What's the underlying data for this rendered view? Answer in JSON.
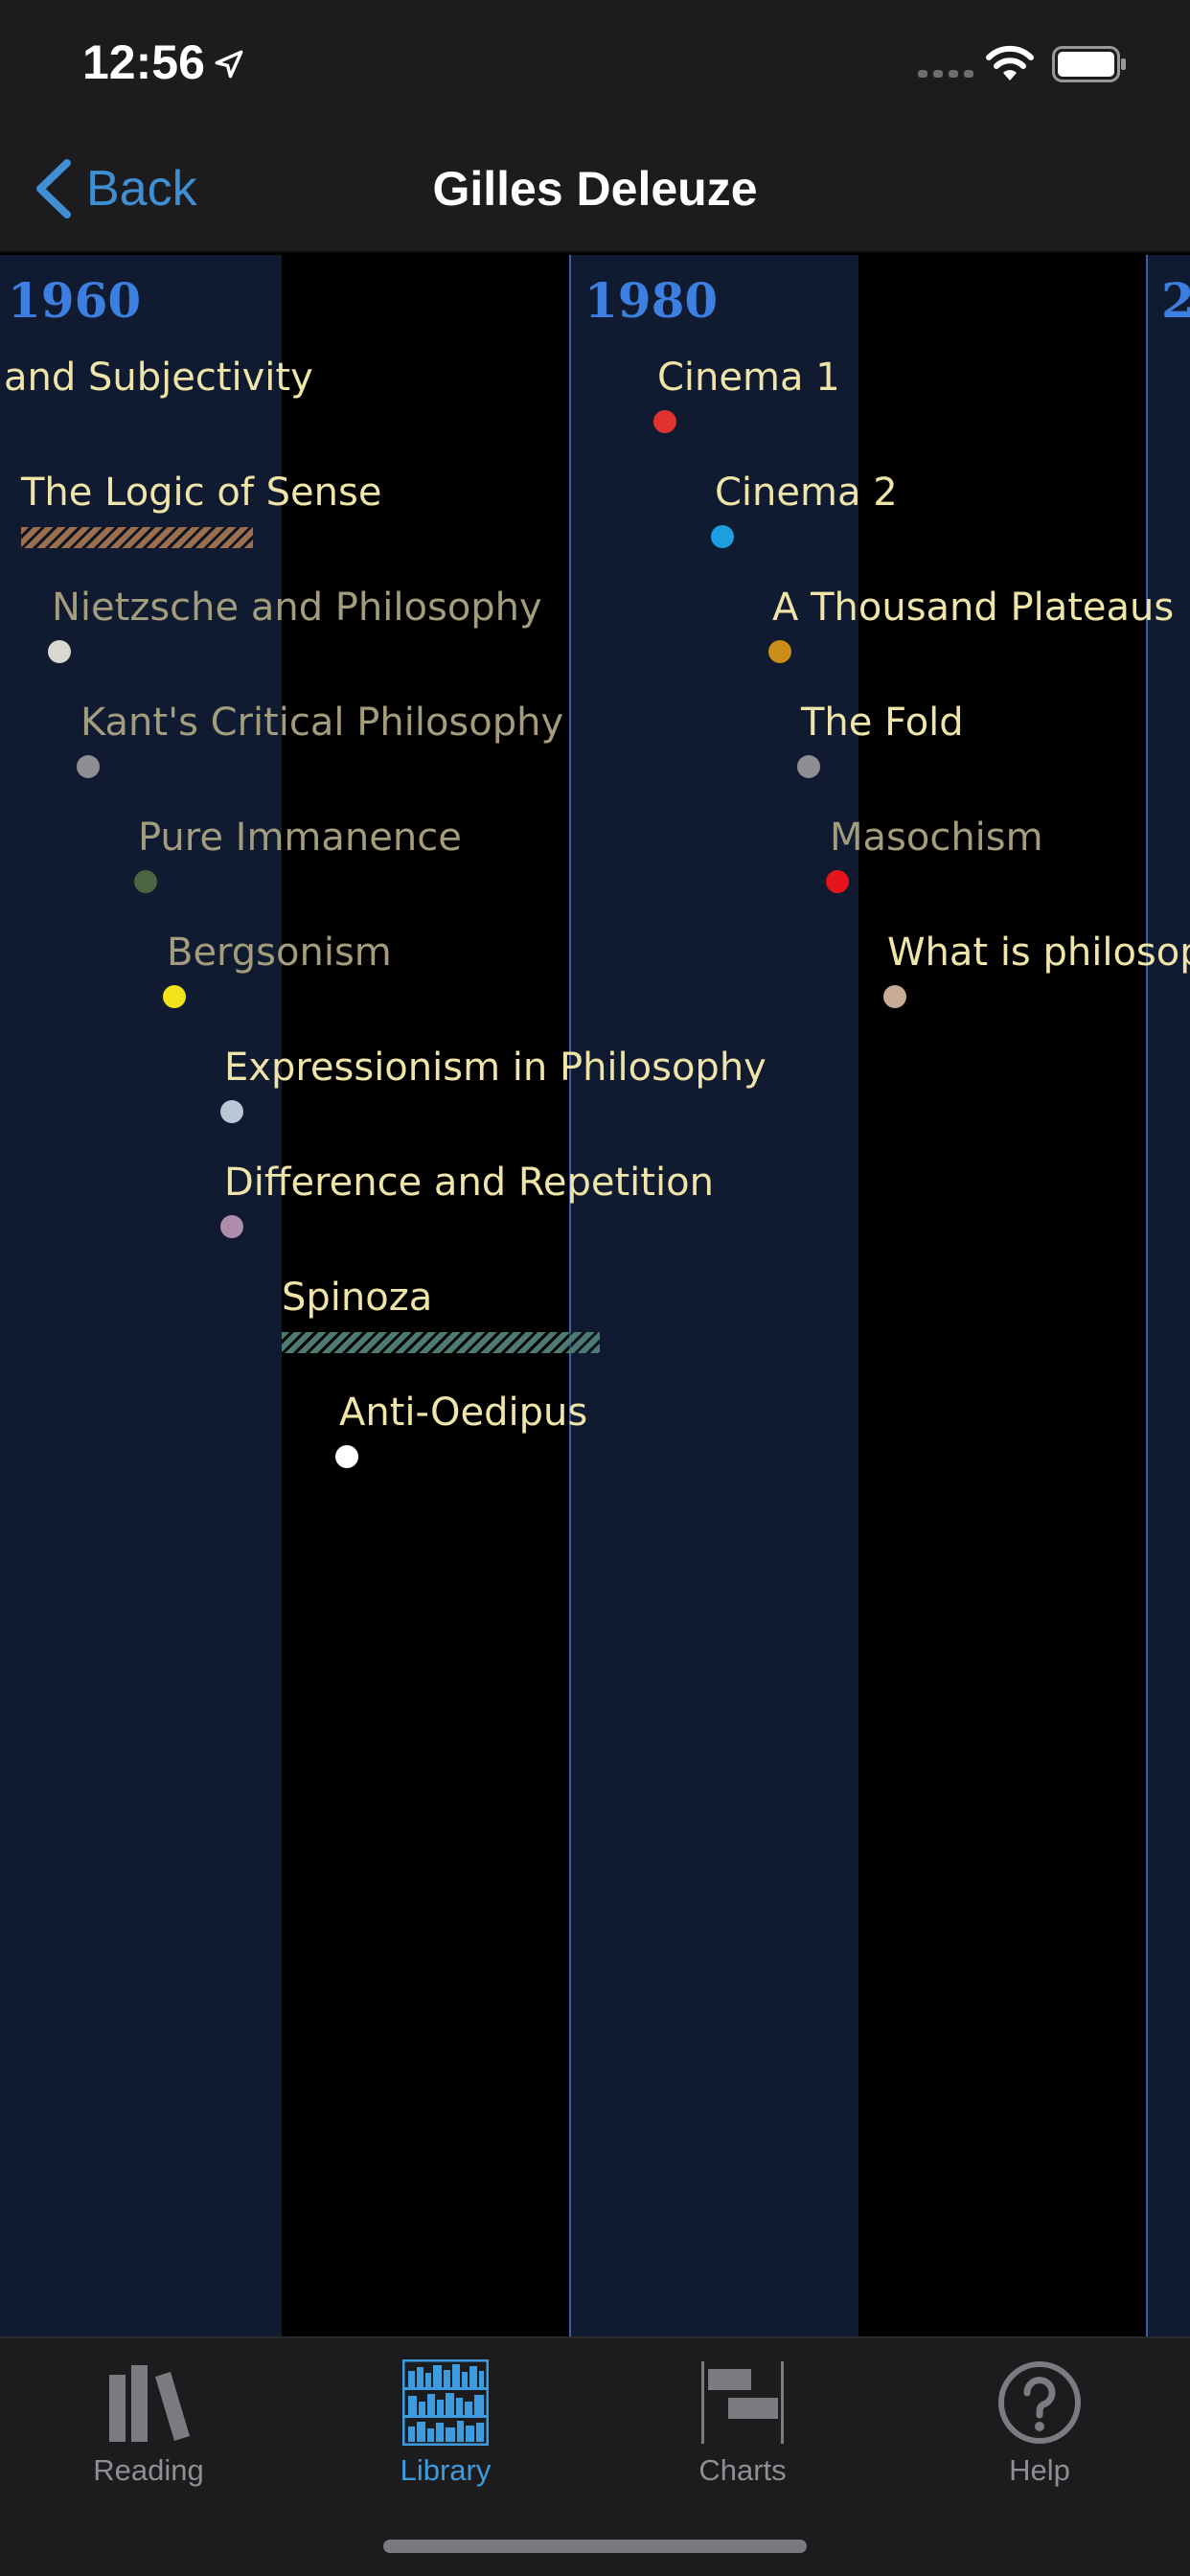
{
  "status_bar": {
    "time": "12:56"
  },
  "nav": {
    "back_label": "Back",
    "title": "Gilles Deleuze"
  },
  "timeline": {
    "decades": [
      "1960",
      "1980",
      "2"
    ],
    "books": [
      {
        "title": "and Subjectivity",
        "style": "bright",
        "marker": "none",
        "color": ""
      },
      {
        "title": "The Logic of Sense",
        "style": "bright",
        "marker": "bar",
        "color": "#9b6e4e"
      },
      {
        "title": "Nietzsche and Philosophy",
        "style": "dim",
        "marker": "dot",
        "color": "#d8d8d0"
      },
      {
        "title": "Kant's Critical Philosophy",
        "style": "dim",
        "marker": "dot",
        "color": "#8e8e93"
      },
      {
        "title": "Pure Immanence",
        "style": "dim",
        "marker": "dot",
        "color": "#4a6444"
      },
      {
        "title": "Bergsonism",
        "style": "dim",
        "marker": "dot",
        "color": "#f2e21a"
      },
      {
        "title": "Expressionism in Philosophy",
        "style": "bright",
        "marker": "dot",
        "color": "#b9c8d4"
      },
      {
        "title": "Difference and Repetition",
        "style": "bright",
        "marker": "dot",
        "color": "#b08cab"
      },
      {
        "title": "Spinoza",
        "style": "bright",
        "marker": "bar",
        "color": "#4d7a72"
      },
      {
        "title": "Anti-Oedipus",
        "style": "bright",
        "marker": "dot",
        "color": "#ffffff"
      },
      {
        "title": "Cinema 1",
        "style": "bright",
        "marker": "dot",
        "color": "#e0332f"
      },
      {
        "title": "Cinema 2",
        "style": "bright",
        "marker": "dot",
        "color": "#1a9fe0"
      },
      {
        "title": "A Thousand Plateaus",
        "style": "bright",
        "marker": "dot",
        "color": "#c98e18"
      },
      {
        "title": "The Fold",
        "style": "bright",
        "marker": "dot",
        "color": "#8e8e93"
      },
      {
        "title": "Masochism",
        "style": "dim",
        "marker": "dot",
        "color": "#e5141c"
      },
      {
        "title": "What is philosop",
        "style": "bright",
        "marker": "dot",
        "color": "#c8ad96"
      }
    ]
  },
  "tabs": [
    {
      "label": "Reading",
      "icon": "books-icon",
      "active": false
    },
    {
      "label": "Library",
      "icon": "library-shelf-icon",
      "active": true
    },
    {
      "label": "Charts",
      "icon": "gantt-chart-icon",
      "active": false
    },
    {
      "label": "Help",
      "icon": "help-question-icon",
      "active": false
    }
  ],
  "colors": {
    "accent": "#3d9be0",
    "decade_label": "#3d7fe0",
    "title_bright": "#f0e5a8",
    "title_dim": "#a39d7e"
  }
}
